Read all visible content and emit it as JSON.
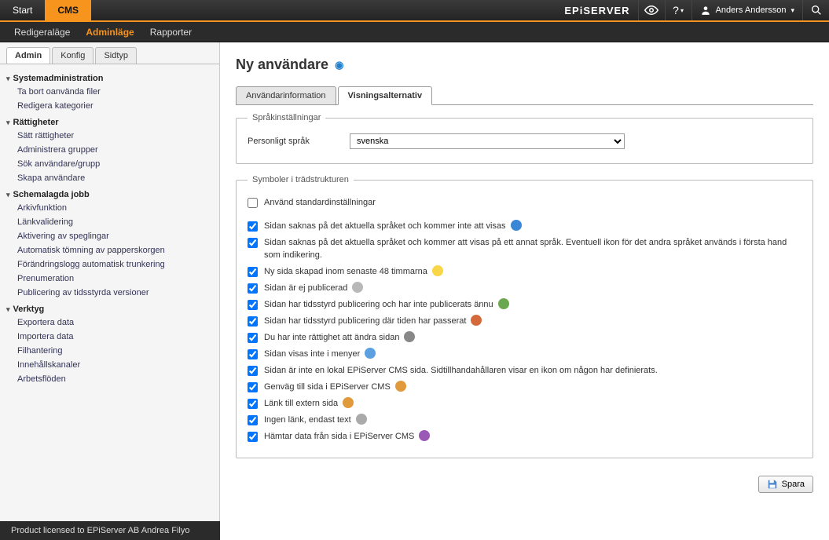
{
  "top_tabs": {
    "start": "Start",
    "cms": "CMS"
  },
  "brand": "EPiSERVER",
  "user_name": "Anders Andersson",
  "menubar": {
    "edit": "Redigeraläge",
    "admin": "Adminläge",
    "reports": "Rapporter"
  },
  "side_tabs": {
    "admin": "Admin",
    "konfig": "Konfig",
    "sidtyp": "Sidtyp"
  },
  "side_groups": {
    "sysadmin": {
      "title": "Systemadministration",
      "items": [
        "Ta bort oanvända filer",
        "Redigera kategorier"
      ]
    },
    "rights": {
      "title": "Rättigheter",
      "items": [
        "Sätt rättigheter",
        "Administrera grupper",
        "Sök användare/grupp",
        "Skapa användare"
      ]
    },
    "sched": {
      "title": "Schemalagda jobb",
      "items": [
        "Arkivfunktion",
        "Länkvalidering",
        "Aktivering av speglingar",
        "Automatisk tömning av papperskorgen",
        "Förändringslogg automatisk trunkering",
        "Prenumeration",
        "Publicering av tidsstyrda versioner"
      ]
    },
    "tools": {
      "title": "Verktyg",
      "items": [
        "Exportera data",
        "Importera data",
        "Filhantering",
        "Innehållskanaler",
        "Arbetsflöden"
      ]
    }
  },
  "page": {
    "title": "Ny användare"
  },
  "ctabs": {
    "info": "Användarinformation",
    "display": "Visningsalternativ"
  },
  "lang_fieldset": {
    "legend": "Språkinställningar",
    "label": "Personligt språk",
    "value": "svenska"
  },
  "tree_fieldset": {
    "legend": "Symboler i trädstrukturen",
    "use_default": {
      "label": "Använd standardinställningar",
      "checked": false
    },
    "items": [
      {
        "label": "Sidan saknas på det aktuella språket och kommer inte att visas",
        "checked": true,
        "icon_color": "#3a87d6"
      },
      {
        "label": "Sidan saknas på det aktuella språket och kommer att visas på ett annat språk. Eventuell ikon för det andra språket används i första hand som indikering.",
        "checked": true,
        "icon_color": ""
      },
      {
        "label": "Ny sida skapad inom senaste 48 timmarna",
        "checked": true,
        "icon_color": "#f8d648"
      },
      {
        "label": "Sidan är ej publicerad",
        "checked": true,
        "icon_color": "#b8b8b8"
      },
      {
        "label": "Sidan har tidsstyrd publicering och har inte publicerats ännu",
        "checked": true,
        "icon_color": "#6aa84f"
      },
      {
        "label": "Sidan har tidsstyrd publicering där tiden har passerat",
        "checked": true,
        "icon_color": "#d46a3b"
      },
      {
        "label": "Du har inte rättighet att ändra sidan",
        "checked": true,
        "icon_color": "#888"
      },
      {
        "label": "Sidan visas inte i menyer",
        "checked": true,
        "icon_color": "#5ba0e0"
      },
      {
        "label": "Sidan är inte en lokal EPiServer CMS sida. Sidtillhandahållaren visar en ikon om någon har definierats.",
        "checked": true,
        "icon_color": ""
      },
      {
        "label": "Genväg till sida i EPiServer CMS",
        "checked": true,
        "icon_color": "#e09a3c"
      },
      {
        "label": "Länk till extern sida",
        "checked": true,
        "icon_color": "#e09a3c"
      },
      {
        "label": "Ingen länk, endast text",
        "checked": true,
        "icon_color": "#aaa"
      },
      {
        "label": "Hämtar data från sida i EPiServer CMS",
        "checked": true,
        "icon_color": "#9b59b6"
      }
    ]
  },
  "save_label": "Spara",
  "footer": "Product licensed to EPiServer AB Andrea Filyo"
}
